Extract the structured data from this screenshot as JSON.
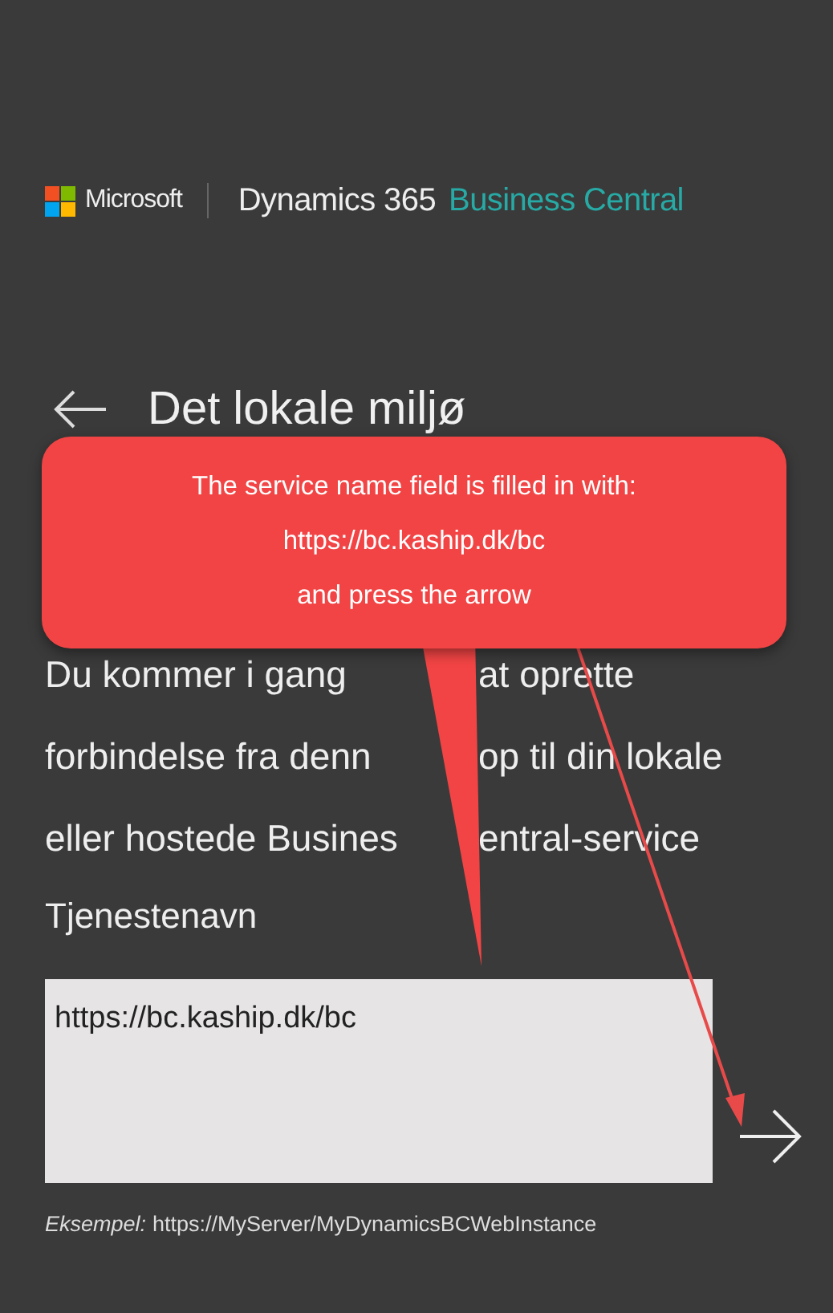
{
  "header": {
    "brand": "Microsoft",
    "product": "Dynamics 365",
    "product_accent": "Business Central"
  },
  "page": {
    "title": "Det lokale miljø",
    "intro_lines": [
      [
        "Du kommer i gang",
        "at oprette"
      ],
      [
        "forbindelse fra denn",
        "op til din lokale"
      ],
      [
        "eller hostede Busines",
        "entral-service"
      ]
    ]
  },
  "field": {
    "label": "Tjenestenavn",
    "value": "https://bc.kaship.dk/bc"
  },
  "example": {
    "label": "Eksempel:",
    "text": "https://MyServer/MyDynamicsBCWebInstance"
  },
  "callout": {
    "lines": [
      "The service name field is filled in with:",
      "https://bc.kaship.dk/bc",
      "and press the arrow"
    ]
  }
}
